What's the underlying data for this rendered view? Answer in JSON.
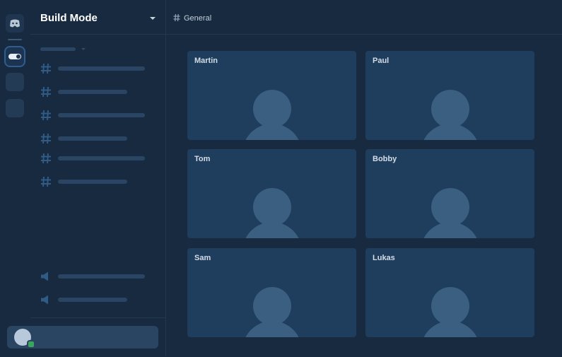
{
  "server": {
    "name": "Build Mode"
  },
  "header": {
    "channel": "General"
  },
  "channels": {
    "text_count": 6,
    "voice_count": 2
  },
  "participants": [
    {
      "name": "Martin"
    },
    {
      "name": "Paul"
    },
    {
      "name": "Tom"
    },
    {
      "name": "Bobby"
    },
    {
      "name": "Sam"
    },
    {
      "name": "Lukas"
    }
  ],
  "user": {
    "status": "online",
    "status_color": "#3ba55d"
  },
  "colors": {
    "background": "#172a40",
    "tile": "#1f3d5c",
    "avatar_silhouette": "#3a5f81"
  },
  "icons": [
    "discord-icon",
    "toggle-icon",
    "hash-icon",
    "speaker-icon"
  ]
}
